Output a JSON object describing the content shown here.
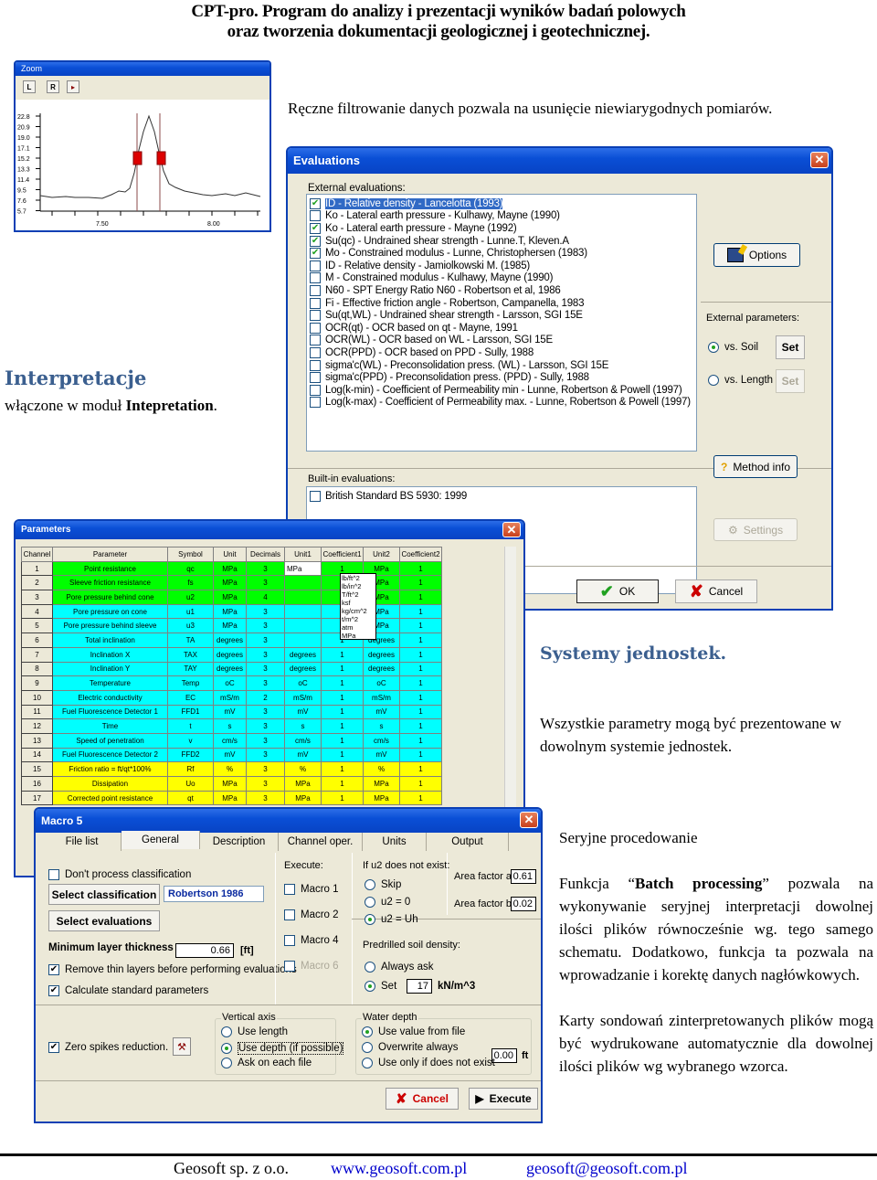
{
  "header": {
    "line1": "CPT-pro. Program do analizy i prezentacji wyników badań polowych",
    "line2": "oraz tworzenia dokumentacji geologicznej i geotechnicznej."
  },
  "zoom_window": {
    "title": "Zoom",
    "buttons": [
      "L",
      "R",
      "▸"
    ],
    "y_ticks": [
      "22.8",
      "20.9",
      "19.0",
      "17.1",
      "15.2",
      "13.3",
      "11.4",
      "9.5",
      "7.6",
      "5.7"
    ],
    "x_ticks": [
      "7.50",
      "8.00"
    ]
  },
  "filter_caption": "Ręczne filtrowanie danych pozwala na usunięcie niewiarygodnych pomiarów.",
  "interp": {
    "heading": "Interpretacje",
    "text_prefix": "włączone w moduł ",
    "text_bold": "Intepretation",
    "text_suffix": "."
  },
  "evaluations": {
    "title": "Evaluations",
    "external_label": "External evaluations:",
    "items": [
      {
        "label": "ID - Relative density - Lancelotta (1993)",
        "checked": true,
        "selected": true
      },
      {
        "label": "Ko - Lateral earth pressure - Kulhawy, Mayne (1990)",
        "checked": false
      },
      {
        "label": "Ko - Lateral earth pressure - Mayne (1992)",
        "checked": true
      },
      {
        "label": "Su(qc) - Undrained shear strength - Lunne.T, Kleven.A",
        "checked": true
      },
      {
        "label": "Mo - Constrained modulus - Lunne, Christophersen (1983)",
        "checked": true
      },
      {
        "label": "ID - Relative density - Jamiolkowski M. (1985)",
        "checked": false
      },
      {
        "label": "M - Constrained modulus - Kulhawy, Mayne (1990)",
        "checked": false
      },
      {
        "label": "N60 - SPT Energy Ratio N60 - Robertson et al, 1986",
        "checked": false
      },
      {
        "label": "Fi - Effective friction angle - Robertson, Campanella, 1983",
        "checked": false
      },
      {
        "label": "Su(qt,WL) - Undrained shear strength - Larsson, SGI 15E",
        "checked": false
      },
      {
        "label": "OCR(qt) - OCR based on qt - Mayne, 1991",
        "checked": false
      },
      {
        "label": "OCR(WL) - OCR based on WL - Larsson, SGI 15E",
        "checked": false
      },
      {
        "label": "OCR(PPD) - OCR based on PPD - Sully, 1988",
        "checked": false
      },
      {
        "label": "sigma'c(WL) - Preconsolidation press. (WL) - Larsson, SGI 15E",
        "checked": false
      },
      {
        "label": "sigma'c(PPD) - Preconsolidation press. (PPD) - Sully, 1988",
        "checked": false
      },
      {
        "label": "Log(k-min) - Coefficient of Permeability min - Lunne, Robertson & Powell (1997)",
        "checked": false
      },
      {
        "label": "Log(k-max) - Coefficient of Permeability max. - Lunne, Robertson & Powell (1997)",
        "checked": false
      }
    ],
    "options_btn": "Options",
    "ext_params_label": "External parameters:",
    "vs_soil": "vs. Soil",
    "vs_length": "vs. Length",
    "set": "Set",
    "method_info": "Method info",
    "builtin_label": "Built-in evaluations:",
    "builtin_items": [
      {
        "label": "British Standard BS 5930: 1999",
        "checked": false
      }
    ],
    "settings": "Settings",
    "ok": "OK",
    "cancel": "Cancel"
  },
  "parameters": {
    "title": "Parameters",
    "columns": [
      "Channel",
      "Parameter",
      "Symbol",
      "Unit",
      "Decimals",
      "Unit1",
      "Coefficient1",
      "Unit2",
      "Coefficient2"
    ],
    "rows": [
      [
        "1",
        "Point resistance",
        "qc",
        "MPa",
        "3",
        "MPa",
        "1",
        "MPa",
        "1",
        "g"
      ],
      [
        "2",
        "Sleeve friction resistance",
        "fs",
        "MPa",
        "3",
        "",
        "1",
        "MPa",
        "1",
        "g"
      ],
      [
        "3",
        "Pore pressure behind cone",
        "u2",
        "MPa",
        "4",
        "",
        "1",
        "MPa",
        "1",
        "g"
      ],
      [
        "4",
        "Pore pressure on cone",
        "u1",
        "MPa",
        "3",
        "",
        "1",
        "MPa",
        "1",
        "c"
      ],
      [
        "5",
        "Pore pressure behind sleeve",
        "u3",
        "MPa",
        "3",
        "",
        "1",
        "MPa",
        "1",
        "c"
      ],
      [
        "6",
        "Total inclination",
        "TA",
        "degrees",
        "3",
        "",
        "1",
        "degrees",
        "1",
        "c"
      ],
      [
        "7",
        "Inclination X",
        "TAX",
        "degrees",
        "3",
        "degrees",
        "1",
        "degrees",
        "1",
        "c"
      ],
      [
        "8",
        "Inclination Y",
        "TAY",
        "degrees",
        "3",
        "degrees",
        "1",
        "degrees",
        "1",
        "c"
      ],
      [
        "9",
        "Temperature",
        "Temp",
        "oC",
        "3",
        "oC",
        "1",
        "oC",
        "1",
        "c"
      ],
      [
        "10",
        "Electric conductivity",
        "EC",
        "mS/m",
        "2",
        "mS/m",
        "1",
        "mS/m",
        "1",
        "c"
      ],
      [
        "11",
        "Fuel Fluorescence Detector 1",
        "FFD1",
        "mV",
        "3",
        "mV",
        "1",
        "mV",
        "1",
        "c"
      ],
      [
        "12",
        "Time",
        "t",
        "s",
        "3",
        "s",
        "1",
        "s",
        "1",
        "c"
      ],
      [
        "13",
        "Speed of penetration",
        "v",
        "cm/s",
        "3",
        "cm/s",
        "1",
        "cm/s",
        "1",
        "c"
      ],
      [
        "14",
        "Fuel Fluorescence Detector 2",
        "FFD2",
        "mV",
        "3",
        "mV",
        "1",
        "mV",
        "1",
        "c"
      ],
      [
        "15",
        "Friction ratio = ft/qt*100%",
        "Rf",
        "%",
        "3",
        "%",
        "1",
        "%",
        "1",
        "y"
      ],
      [
        "16",
        "Dissipation",
        "Uo",
        "MPa",
        "3",
        "MPa",
        "1",
        "MPa",
        "1",
        "y"
      ],
      [
        "17",
        "Corrected point resistance",
        "qt",
        "MPa",
        "3",
        "MPa",
        "1",
        "MPa",
        "1",
        "y"
      ]
    ],
    "unit_dropdown": [
      "lb/ft^2",
      "lb/in^2",
      "T/ft^2",
      "ksf",
      "kg/cm^2",
      "t/m^2",
      "atm",
      "MPa"
    ]
  },
  "units_section": {
    "heading": "Systemy jednostek.",
    "text": "Wszystkie parametry mogą być prezentowane w dowolnym systemie jednostek."
  },
  "macro": {
    "title": "Macro 5",
    "tabs": [
      "File list",
      "General",
      "Description",
      "Channel oper.",
      "Units",
      "Output"
    ],
    "active_tab": "General",
    "dont_process": "Don't process classification",
    "select_classification": "Select classification",
    "classification_value": "Robertson 1986",
    "select_evaluations": "Select evaluations",
    "min_layer_label": "Minimum layer thickness",
    "min_layer_value": "0.66",
    "min_layer_unit": "[ft]",
    "remove_thin": "Remove thin layers before performing evaluations",
    "calc_standard": "Calculate standard parameters",
    "execute_label": "Execute:",
    "macros": [
      {
        "label": "Macro 1",
        "checked": false,
        "disabled": false
      },
      {
        "label": "Macro 2",
        "checked": false,
        "disabled": false
      },
      {
        "label": "Macro 4",
        "checked": false,
        "disabled": false
      },
      {
        "label": "Macro 6",
        "checked": false,
        "disabled": true
      }
    ],
    "u2_label": "If u2 does not exist:",
    "u2_options": [
      {
        "label": "Skip",
        "on": false
      },
      {
        "label": "u2 = 0",
        "on": false
      },
      {
        "label": "u2 = Uh",
        "on": true
      }
    ],
    "area_a_label": "Area factor a",
    "area_a": "0.61",
    "area_b_label": "Area factor b",
    "area_b": "0.02",
    "predrilled_label": "Predrilled soil density:",
    "always_ask": "Always ask",
    "set_label": "Set",
    "density": "17",
    "density_unit": "kN/m^3",
    "zero_spikes": "Zero spikes reduction.",
    "vertical_axis_label": "Vertical axis",
    "vertical_options": [
      {
        "label": "Use length",
        "on": false
      },
      {
        "label": "Use depth (if possible)",
        "on": true
      },
      {
        "label": "Ask on each file",
        "on": false
      }
    ],
    "water_label": "Water depth",
    "water_options": [
      {
        "label": "Use value from file",
        "on": true
      },
      {
        "label": "Overwrite always",
        "on": false
      },
      {
        "label": "Use only if does not exist",
        "on": false
      }
    ],
    "water_value": "0.00",
    "water_unit": "ft",
    "cancel": "Cancel",
    "execute": "Execute"
  },
  "batch": {
    "heading": "Seryjne procedowanie",
    "p1_a": "Funkcja “",
    "p1_bold": "Batch processing",
    "p1_b": "” pozwala na wykonywanie seryjnej interpretacji dowolnej ilości plików równocześnie wg. tego samego schematu. Dodatkowo, funkcja ta pozwala na wprowadzanie i korektę danych nagłówkowych.",
    "p2": "Karty sondowań zinterpretowanych plików mogą być wydrukowane automatycznie dla dowolnej ilości plików wg wybranego wzorca."
  },
  "footer": {
    "company": "Geosoft sp. z o.o.",
    "website": "www.geosoft.com.pl",
    "email": "geosoft@geosoft.com.pl"
  }
}
